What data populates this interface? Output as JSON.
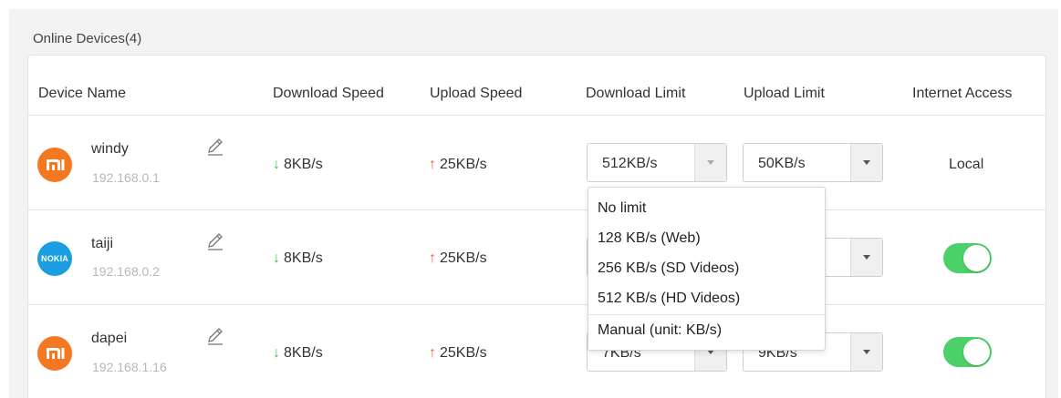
{
  "panel": {
    "title": "Online Devices(4)"
  },
  "columns": {
    "device_name": "Device Name",
    "download_speed": "Download Speed",
    "upload_speed": "Upload Speed",
    "download_limit": "Download Limit",
    "upload_limit": "Upload Limit",
    "internet_access": "Internet Access"
  },
  "devices": [
    {
      "name": "windy",
      "ip": "192.168.0.1",
      "avatar_icon": "xiaomi-logo",
      "download_speed": "8KB/s",
      "upload_speed": "25KB/s",
      "download_limit": "512KB/s",
      "upload_limit": "50KB/s",
      "internet_access": "Local"
    },
    {
      "name": "taiji",
      "ip": "192.168.0.2",
      "avatar_icon": "nokia-logo",
      "avatar_text": "NOKIA",
      "download_speed": "8KB/s",
      "upload_speed": "25KB/s",
      "upload_limit": "",
      "internet_access_enabled": true
    },
    {
      "name": "dapei",
      "ip": "192.168.1.16",
      "avatar_icon": "xiaomi-logo",
      "download_speed": "8KB/s",
      "upload_speed": "25KB/s",
      "download_limit": "7KB/s",
      "upload_limit": "9KB/s",
      "internet_access_enabled": true
    }
  ],
  "arrows": {
    "down": "↓",
    "up": "↑"
  },
  "dropdown": {
    "options": [
      "No limit",
      "128 KB/s (Web)",
      "256 KB/s (SD Videos)",
      "512 KB/s (HD Videos)"
    ],
    "manual": "Manual (unit: KB/s)"
  },
  "colors": {
    "accent_green": "#4cd069",
    "xiaomi_orange": "#f47721",
    "nokia_blue": "#1a9de1",
    "down_arrow": "#3cbf5a",
    "up_arrow": "#f05a3c"
  }
}
